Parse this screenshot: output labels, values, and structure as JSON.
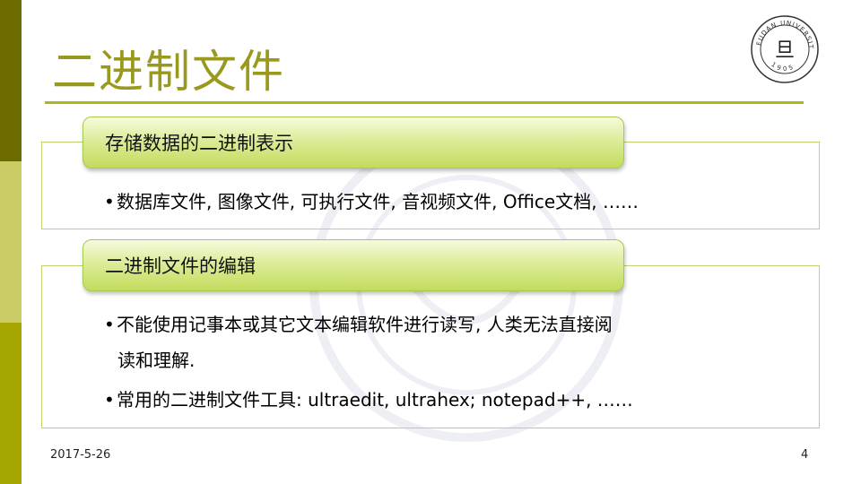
{
  "slide": {
    "title": "二进制文件",
    "date": "2017-5-26",
    "page_number": "4"
  },
  "logo": {
    "name": "fudan-university-seal",
    "text_top": "FUDAN UNIVERSITY",
    "text_bottom": "1905",
    "glyph": "旦"
  },
  "colors": {
    "title": "#99991f",
    "rule": "#b4b41a",
    "tab_gradient_top": "#f6fbdc",
    "tab_gradient_bottom": "#c2dc5c",
    "panel_border": "#bcd36e",
    "side_bar_dark": "#6b6b00",
    "side_bar_light": "#cccc66",
    "side_bar_mid": "#a6a600"
  },
  "sections": [
    {
      "heading": "存储数据的二进制表示",
      "bullets": [
        "数据库文件, 图像文件, 可执行文件, 音视频文件, Office文档, ……"
      ]
    },
    {
      "heading": "二进制文件的编辑",
      "bullets": [
        "不能使用记事本或其它文本编辑软件进行读写, 人类无法直接阅",
        "读和理解.",
        "常用的二进制文件工具: ultraedit, ultrahex; notepad++, ……"
      ]
    }
  ]
}
